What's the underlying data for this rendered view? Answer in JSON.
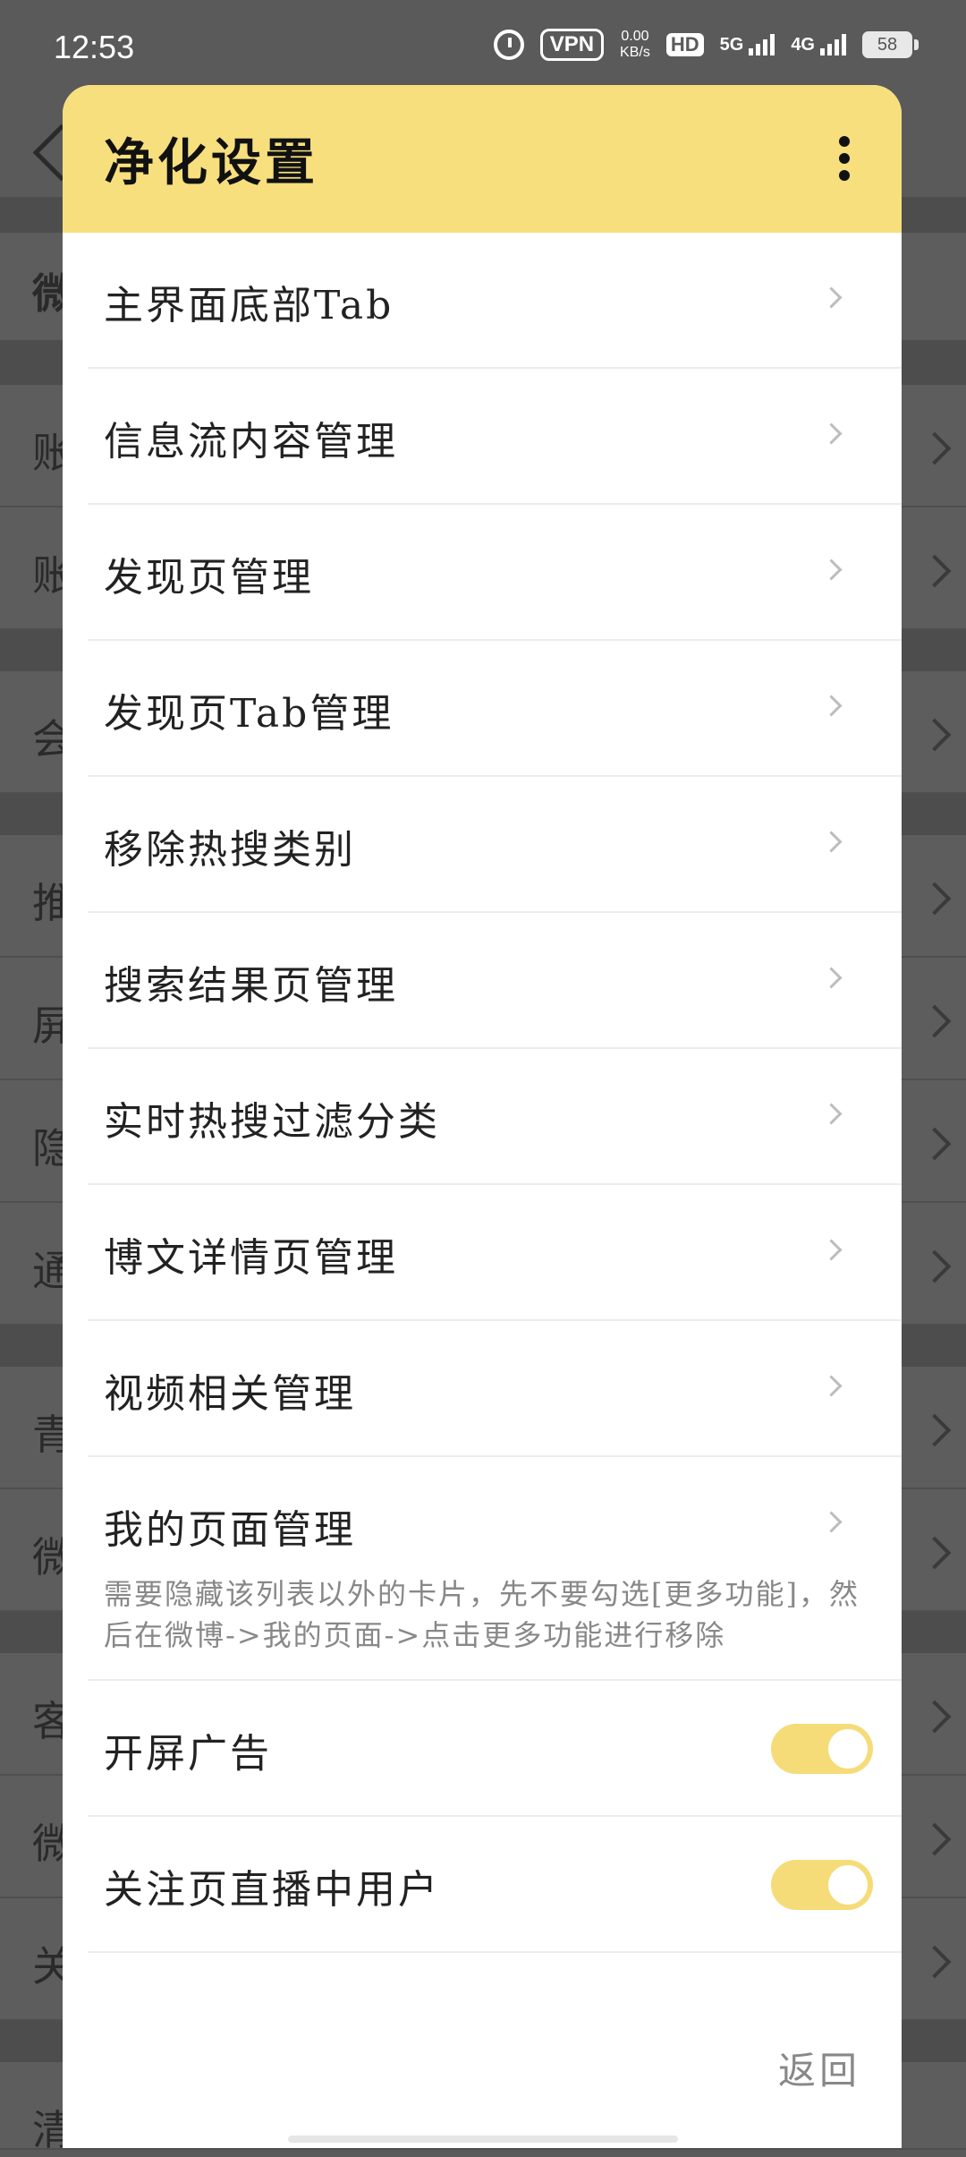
{
  "status_bar": {
    "time": "12:53",
    "vpn": "VPN",
    "speed_value": "0.00",
    "speed_unit": "KB/s",
    "hd": "HD",
    "net1": "5G",
    "net2": "4G",
    "battery": "58"
  },
  "background": {
    "chars": [
      "微",
      "账",
      "账",
      "会",
      "推",
      "屏",
      "隐",
      "通",
      "青",
      "微",
      "客",
      "微",
      "关",
      "清"
    ]
  },
  "dialog": {
    "title": "净化设置",
    "menu_icon": "more-vertical-icon",
    "items": [
      {
        "label": "主界面底部Tab"
      },
      {
        "label": "信息流内容管理"
      },
      {
        "label": "发现页管理"
      },
      {
        "label": "发现页Tab管理"
      },
      {
        "label": "移除热搜类别"
      },
      {
        "label": "搜索结果页管理"
      },
      {
        "label": "实时热搜过滤分类"
      },
      {
        "label": "博文详情页管理"
      },
      {
        "label": "视频相关管理"
      },
      {
        "label": "我的页面管理",
        "description": "需要隐藏该列表以外的卡片，先不要勾选[更多功能]，然后在微博->我的页面->点击更多功能进行移除"
      }
    ],
    "toggles": [
      {
        "label": "开屏广告",
        "on": true
      },
      {
        "label": "关注页直播中用户",
        "on": true
      }
    ],
    "return_label": "返回",
    "accent_color": "#f7df7e"
  }
}
